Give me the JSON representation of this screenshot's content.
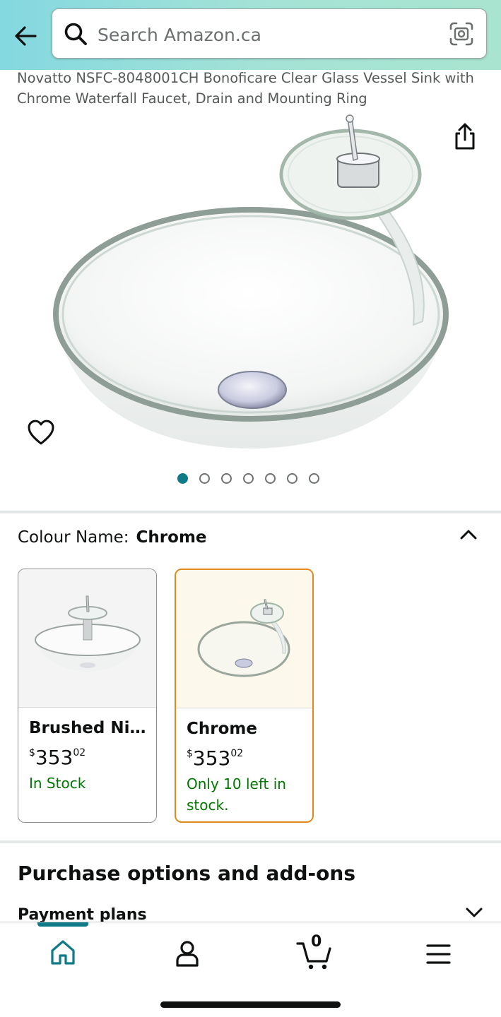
{
  "search": {
    "placeholder": "Search Amazon.ca"
  },
  "product": {
    "title": "Novatto NSFC-8048001CH Bonoficare Clear Glass Vessel Sink with Chrome Waterfall Faucet, Drain and Mounting Ring",
    "image_count": 7,
    "active_image": 1
  },
  "colour": {
    "label": "Colour Name:",
    "value": "Chrome"
  },
  "variants": [
    {
      "name": "Brushed Nic...",
      "currency": "$",
      "price_whole": "353",
      "price_fraction": "02",
      "stock": "In Stock",
      "selected": false
    },
    {
      "name": "Chrome",
      "currency": "$",
      "price_whole": "353",
      "price_fraction": "02",
      "stock": "Only 10 left in stock.",
      "selected": true
    }
  ],
  "purchase_options": {
    "title": "Purchase options and add-ons",
    "payment_plans": "Payment plans"
  },
  "nav": {
    "cart_count": "0",
    "active_tab": "home"
  },
  "colors": {
    "accent": "#0f7b89",
    "stock_green": "#007600",
    "selected_border": "#e08a1e"
  }
}
